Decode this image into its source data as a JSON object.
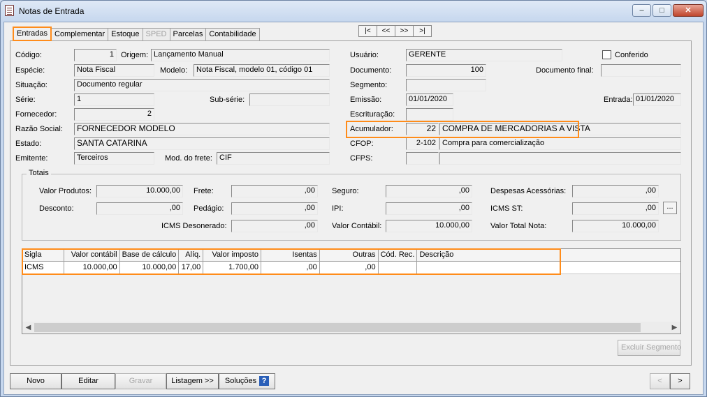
{
  "window": {
    "title": "Notas de Entrada"
  },
  "tabs": [
    "Entradas",
    "Complementar",
    "Estoque",
    "SPED",
    "Parcelas",
    "Contabilidade"
  ],
  "nav": [
    "|<",
    "<<",
    ">>",
    ">|"
  ],
  "form": {
    "codigo_label": "Código:",
    "codigo": "1",
    "origem_label": "Origem:",
    "origem": "Lançamento Manual",
    "especie_label": "Espécie:",
    "especie": "Nota Fiscal",
    "modelo_label": "Modelo:",
    "modelo": "Nota Fiscal, modelo 01, código 01",
    "situacao_label": "Situação:",
    "situacao": "Documento regular",
    "serie_label": "Série:",
    "serie": "1",
    "subserie_label": "Sub-série:",
    "subserie": "",
    "fornecedor_label": "Fornecedor:",
    "fornecedor": "2",
    "razao_label": "Razão Social:",
    "razao": "FORNECEDOR MODELO",
    "estado_label": "Estado:",
    "estado": "SANTA CATARINA",
    "emitente_label": "Emitente:",
    "emitente": "Terceiros",
    "frete_label": "Mod. do frete:",
    "frete": "CIF",
    "usuario_label": "Usuário:",
    "usuario": "GERENTE",
    "conferido_label": "Conferido",
    "documento_label": "Documento:",
    "documento": "100",
    "docfinal_label": "Documento final:",
    "docfinal": "",
    "segmento_label": "Segmento:",
    "segmento": "",
    "emissao_label": "Emissão:",
    "emissao": "01/01/2020",
    "entrada_label": "Entrada:",
    "entrada": "01/01/2020",
    "escrituracao_label": "Escrituração:",
    "escrituracao": "",
    "acumulador_label": "Acumulador:",
    "acumulador_code": "22",
    "acumulador_desc": "COMPRA DE MERCADORIAS A VISTA",
    "cfop_label": "CFOP:",
    "cfop_code": "2-102",
    "cfop_desc": "Compra para comercialização",
    "cfps_label": "CFPS:",
    "cfps_code": "",
    "cfps_desc": ""
  },
  "totais": {
    "title": "Totais",
    "valor_produtos_label": "Valor Produtos:",
    "valor_produtos": "10.000,00",
    "frete_label": "Frete:",
    "frete": ",00",
    "seguro_label": "Seguro:",
    "seguro": ",00",
    "despesas_label": "Despesas Acessórias:",
    "despesas": ",00",
    "desconto_label": "Desconto:",
    "desconto": ",00",
    "pedagio_label": "Pedágio:",
    "pedagio": ",00",
    "ipi_label": "IPI:",
    "ipi": ",00",
    "icms_st_label": "ICMS ST:",
    "icms_st": ",00",
    "more_btn": "...",
    "icms_desonerado_label": "ICMS Desonerado:",
    "icms_desonerado": ",00",
    "valor_contabil_label": "Valor Contábil:",
    "valor_contabil": "10.000,00",
    "valor_total_label": "Valor Total Nota:",
    "valor_total": "10.000,00"
  },
  "grid": {
    "columns": [
      "Sigla",
      "Valor contábil",
      "Base de cálculo",
      "Alíq.",
      "Valor imposto",
      "Isentas",
      "Outras",
      "Cód. Rec.",
      "Descrição"
    ],
    "rows": [
      [
        "ICMS",
        "10.000,00",
        "10.000,00",
        "17,00",
        "1.700,00",
        ",00",
        ",00",
        "",
        ""
      ]
    ]
  },
  "buttons": {
    "excluir_segmento": "Excluir Segmento",
    "novo": "Novo",
    "editar": "Editar",
    "gravar": "Gravar",
    "listagem": "Listagem >>",
    "solucoes": "Soluções",
    "prev": "<",
    "next": ">"
  },
  "colors": {
    "highlight": "#ff8c1a",
    "help_icon": "#2a5fb8"
  }
}
